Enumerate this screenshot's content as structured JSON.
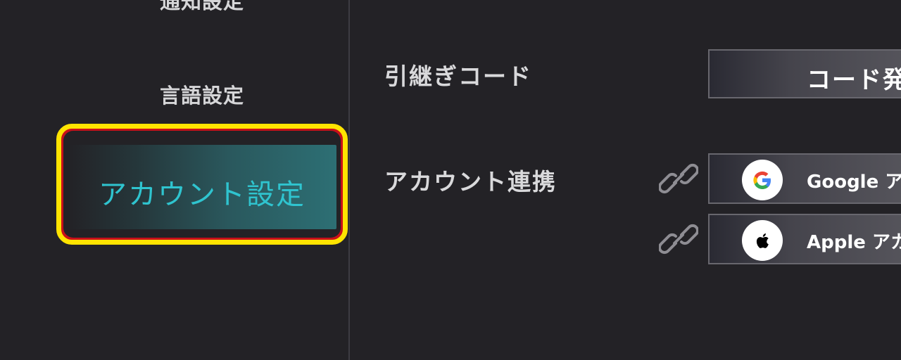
{
  "sidebar": {
    "items": [
      {
        "label": "通知設定"
      },
      {
        "label": "言語設定"
      },
      {
        "label": "アカウント設定",
        "active": true
      }
    ]
  },
  "content": {
    "transfer_code": {
      "label": "引継ぎコード",
      "button_label": "コード発"
    },
    "account_link": {
      "label": "アカウント連携",
      "google": {
        "label": "Google アカ",
        "icon": "google-icon"
      },
      "apple": {
        "label": "Apple アカ",
        "icon": "apple-icon"
      },
      "link_icon": "chain-link-icon"
    }
  },
  "colors": {
    "background": "#232226",
    "highlight_border": "#ffe400",
    "highlight_outer": "#c8101a",
    "active_text": "#2fc4cf"
  }
}
